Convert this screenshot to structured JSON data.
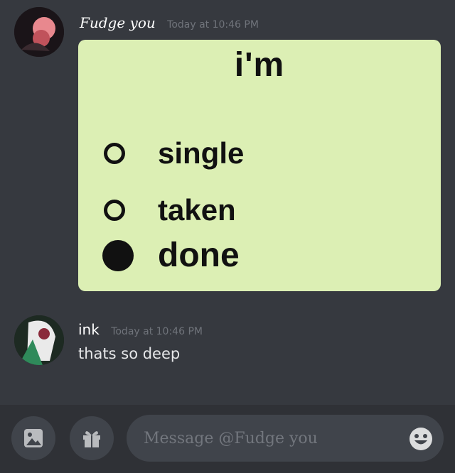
{
  "messages": [
    {
      "author": "Fudge you",
      "timestamp": "Today at 10:46 PM",
      "poll": {
        "title": "i'm",
        "options": [
          {
            "label": "single",
            "selected": false
          },
          {
            "label": "taken",
            "selected": false
          },
          {
            "label": "done",
            "selected": true
          }
        ]
      }
    },
    {
      "author": "ink",
      "timestamp": "Today at 10:46 PM",
      "text": "thats so deep"
    }
  ],
  "composer": {
    "placeholder": "Message @Fudge you",
    "buttons": [
      "image-icon",
      "gift-icon",
      "emoji-icon"
    ]
  },
  "colors": {
    "background": "#36393f",
    "poll_background": "#dcefb4",
    "input_background": "#40444b"
  }
}
